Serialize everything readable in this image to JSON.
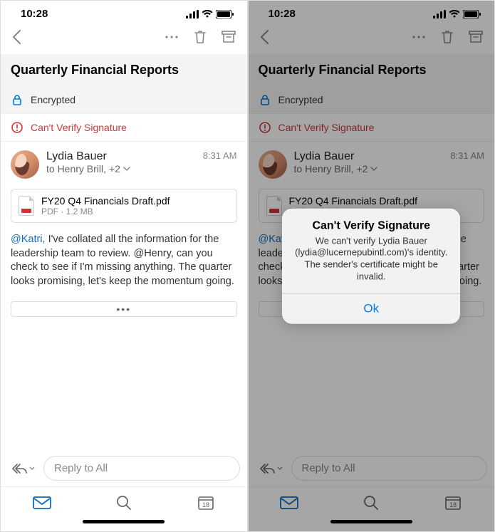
{
  "status": {
    "time": "10:28"
  },
  "subject": "Quarterly Financial Reports",
  "banner_encrypted": "Encrypted",
  "banner_error": "Can't Verify Signature",
  "message": {
    "from": "Lydia Bauer",
    "to": "to Henry Brill, +2",
    "time": "8:31 AM",
    "body_plain": "I've collated all the information for the leadership team to review. @Henry, can you check to see if I'm missing anything. The quarter looks promising, let's keep the momentum going."
  },
  "mention": "@Katri,",
  "attachment": {
    "name": "FY20 Q4 Financials Draft.pdf",
    "meta": "PDF · 1.2 MB"
  },
  "reply_placeholder": "Reply to All",
  "calendar_day": "18",
  "alert": {
    "title": "Can't Verify Signature",
    "message": "We can't verify Lydia Bauer (lydia@lucernepubintl.com)'s identity. The sender's certificate might be invalid.",
    "ok": "Ok"
  }
}
